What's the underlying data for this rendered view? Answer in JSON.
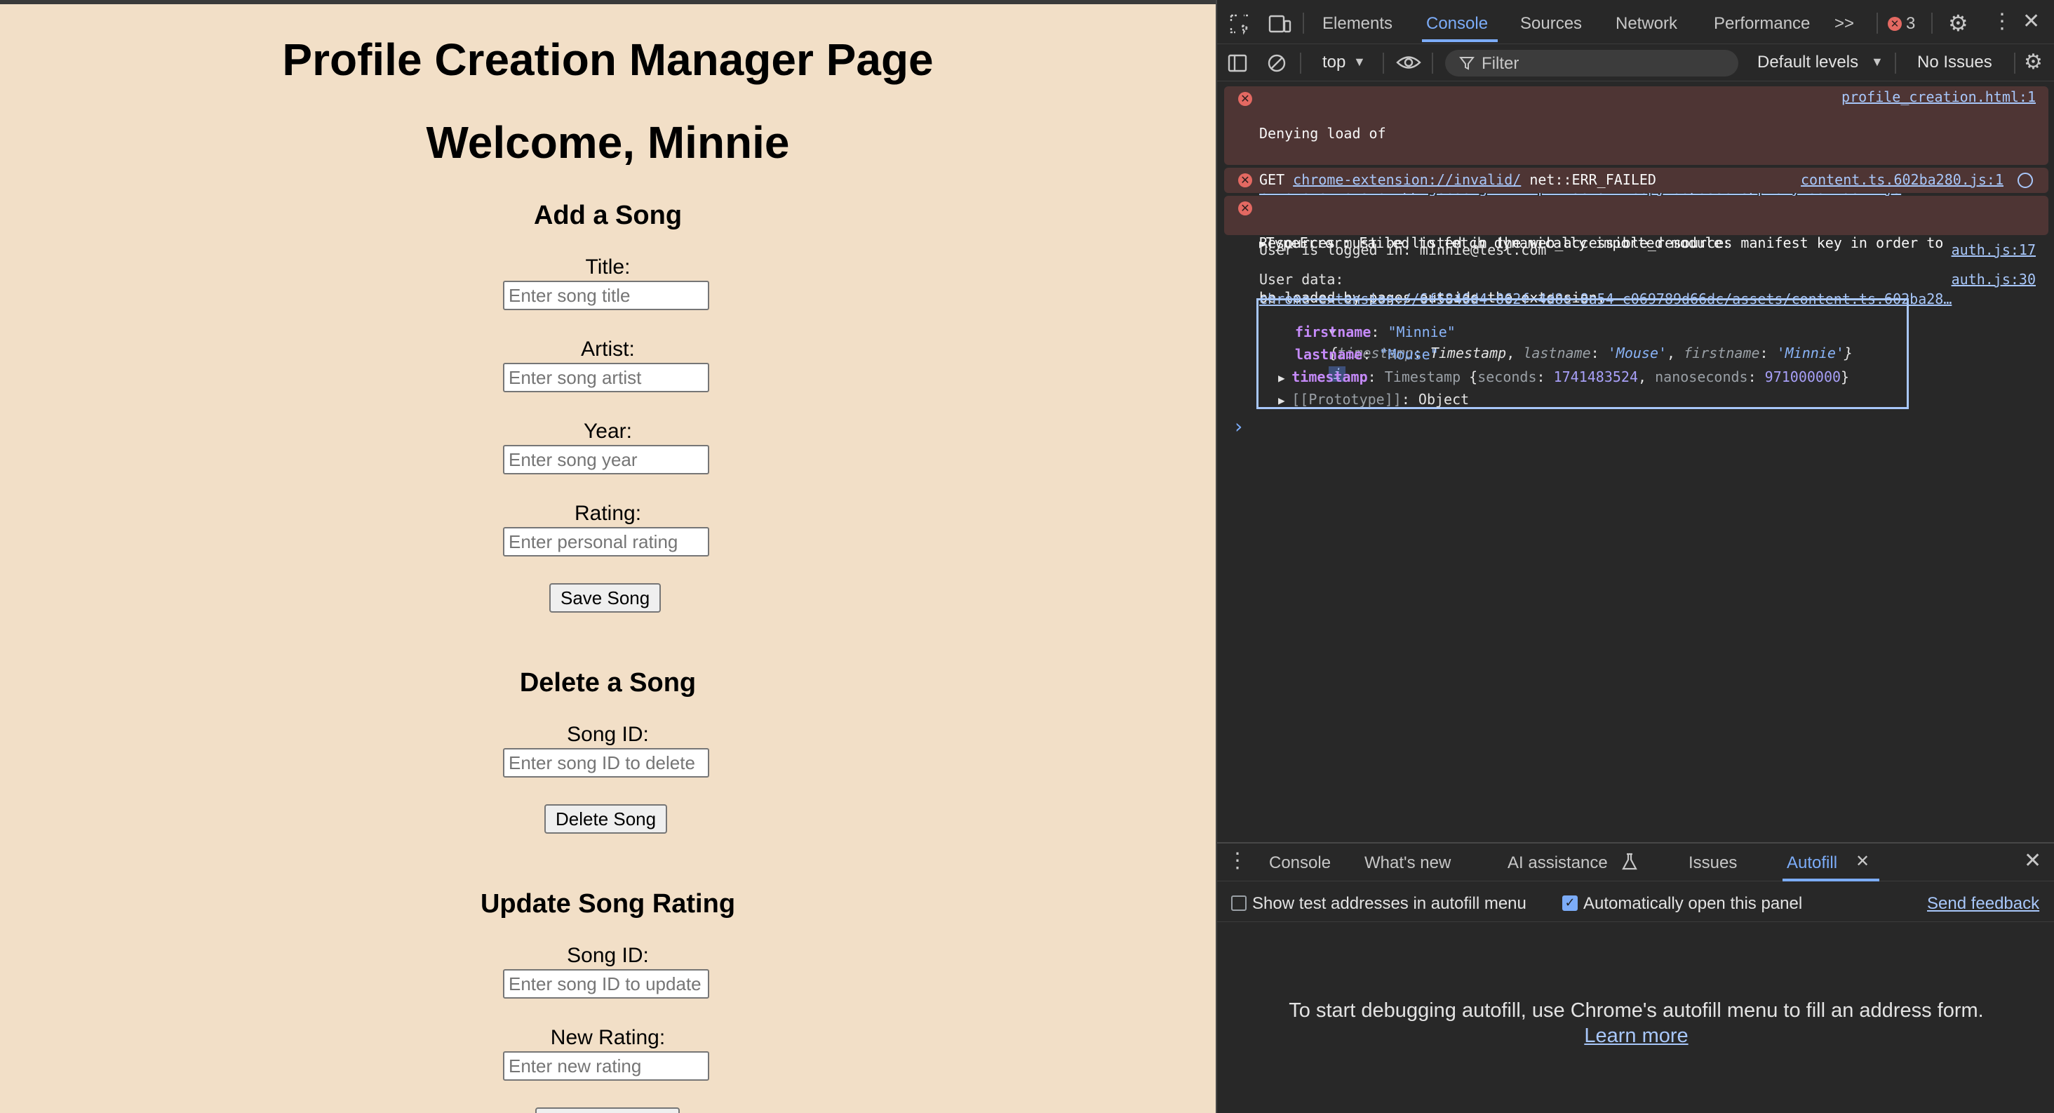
{
  "webpage": {
    "title": "Profile Creation Manager Page",
    "welcome": "Welcome, Minnie",
    "add_song": {
      "heading": "Add a Song",
      "title_label": "Title:",
      "title_placeholder": "Enter song title",
      "artist_label": "Artist:",
      "artist_placeholder": "Enter song artist",
      "year_label": "Year:",
      "year_placeholder": "Enter song year",
      "rating_label": "Rating:",
      "rating_placeholder": "Enter personal rating",
      "save_button": "Save Song"
    },
    "delete_song": {
      "heading": "Delete a Song",
      "id_label": "Song ID:",
      "id_placeholder": "Enter song ID to delete",
      "delete_button": "Delete Song"
    },
    "update_rating": {
      "heading": "Update Song Rating",
      "id_label": "Song ID:",
      "id_placeholder": "Enter song ID to update",
      "rating_label": "New Rating:",
      "rating_placeholder": "Enter new rating"
    }
  },
  "devtools": {
    "tabs": [
      "Elements",
      "Console",
      "Sources",
      "Network",
      "Performance"
    ],
    "active_tab": "Console",
    "more_tabs": ">>",
    "error_count": "3",
    "toolbar": {
      "context": "top",
      "filter_placeholder": "Filter",
      "levels": "Default levels",
      "issues": "No Issues"
    },
    "console": {
      "error1": {
        "prefix": "Denying load of ",
        "link": "chrome-extension://kgbcoelgfffkmkpfnldemdinmcbpjlaa/assets/proxy.3d42db12.js",
        "after_link": ".",
        "line2": "Resources must be listed in the web_accessible_resources manifest key in order to",
        "line3": "be loaded by pages outside the extension.",
        "source": "profile_creation.html:1"
      },
      "error2": {
        "method": "GET ",
        "link": "chrome-extension://invalid/",
        "tail": " net::ERR_FAILED",
        "source": "content.ts.602ba280.js:1"
      },
      "error3": {
        "text": "TypeError: Failed to fetch dynamically imported module:",
        "link": "chrome-extension://6f5846d4-862f-4d8e-8a54-c069789d66dc/assets/content.ts.602ba28…"
      },
      "log1": {
        "text": "User is logged in: minnie@test.com",
        "source": "auth.js:17"
      },
      "log2": {
        "text": "User data:",
        "source": "auth.js:30"
      },
      "object": {
        "summary_open": "{",
        "summary_ts_key": "timestamp",
        "summary_ts_val": "Timestamp",
        "summary_ln_key": "lastname",
        "summary_ln_val": "'Mouse'",
        "summary_fn_key": "firstname",
        "summary_fn_val": "'Minnie'",
        "summary_close": "}",
        "info_badge": "i",
        "firstname_key": "firstname",
        "firstname_val": "\"Minnie\"",
        "lastname_key": "lastname",
        "lastname_val": "\"Mouse\"",
        "timestamp_key": "timestamp",
        "timestamp_type": "Timestamp",
        "seconds_key": "seconds",
        "seconds_val": "1741483524",
        "nanos_key": "nanoseconds",
        "nanos_val": "971000000",
        "proto_key": "[[Prototype]]",
        "proto_val": "Object"
      },
      "prompt": "›"
    },
    "drawer": {
      "tabs": [
        "Console",
        "What's new",
        "AI assistance",
        "Issues",
        "Autofill"
      ],
      "active_tab": "Autofill",
      "checkbox1_label": "Show test addresses in autofill menu",
      "checkbox1_checked": false,
      "checkbox2_label": "Automatically open this panel",
      "checkbox2_checked": true,
      "send_feedback": "Send feedback",
      "empty_message": "To start debugging autofill, use Chrome's autofill menu to fill an address form.",
      "learn_more": "Learn more"
    }
  }
}
